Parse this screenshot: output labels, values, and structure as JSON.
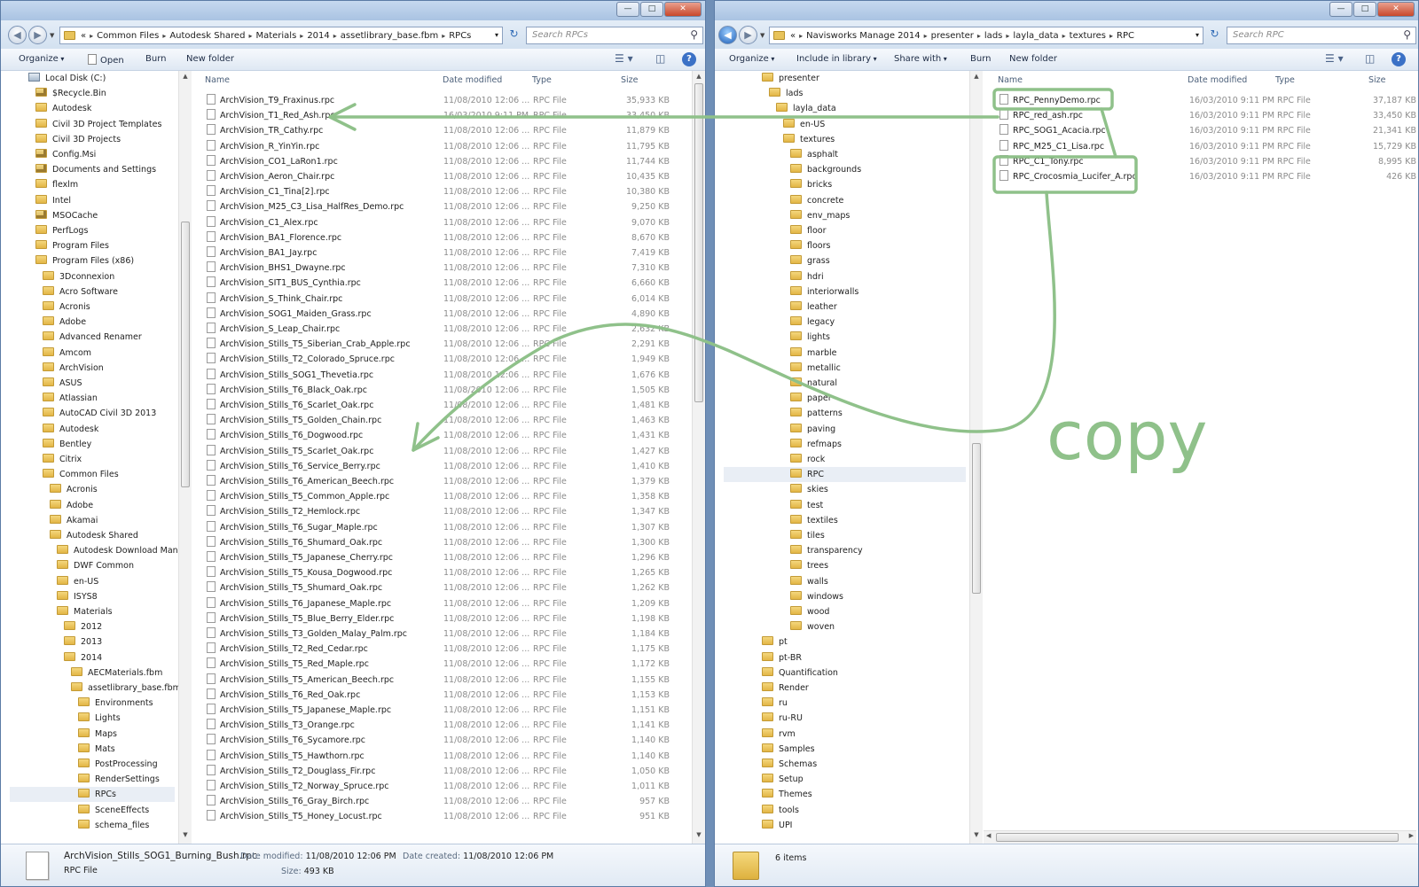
{
  "left": {
    "nav": {
      "back": "◀",
      "forward": "▶"
    },
    "address": [
      "«",
      "Common Files",
      "Autodesk Shared",
      "Materials",
      "2014",
      "assetlibrary_base.fbm",
      "RPCs"
    ],
    "search_placeholder": "Search RPCs",
    "toolbar": {
      "organize": "Organize",
      "open": "Open",
      "burn": "Burn",
      "new_folder": "New folder"
    },
    "columns": {
      "name": "Name",
      "date": "Date modified",
      "type": "Type",
      "size": "Size"
    },
    "tree": [
      {
        "label": "Local Disk (C:)",
        "indent": 0,
        "icon": "drive"
      },
      {
        "label": "$Recycle.Bin",
        "indent": 1,
        "icon": "lock"
      },
      {
        "label": "Autodesk",
        "indent": 1,
        "icon": "folder"
      },
      {
        "label": "Civil 3D Project Templates",
        "indent": 1,
        "icon": "folder"
      },
      {
        "label": "Civil 3D Projects",
        "indent": 1,
        "icon": "folder"
      },
      {
        "label": "Config.Msi",
        "indent": 1,
        "icon": "lock"
      },
      {
        "label": "Documents and Settings",
        "indent": 1,
        "icon": "lock"
      },
      {
        "label": "flexlm",
        "indent": 1,
        "icon": "folder"
      },
      {
        "label": "Intel",
        "indent": 1,
        "icon": "folder"
      },
      {
        "label": "MSOCache",
        "indent": 1,
        "icon": "lock"
      },
      {
        "label": "PerfLogs",
        "indent": 1,
        "icon": "folder"
      },
      {
        "label": "Program Files",
        "indent": 1,
        "icon": "folder"
      },
      {
        "label": "Program Files (x86)",
        "indent": 1,
        "icon": "folder"
      },
      {
        "label": "3Dconnexion",
        "indent": 2,
        "icon": "folder"
      },
      {
        "label": "Acro Software",
        "indent": 2,
        "icon": "folder"
      },
      {
        "label": "Acronis",
        "indent": 2,
        "icon": "folder"
      },
      {
        "label": "Adobe",
        "indent": 2,
        "icon": "folder"
      },
      {
        "label": "Advanced Renamer",
        "indent": 2,
        "icon": "folder"
      },
      {
        "label": "Amcom",
        "indent": 2,
        "icon": "folder"
      },
      {
        "label": "ArchVision",
        "indent": 2,
        "icon": "folder"
      },
      {
        "label": "ASUS",
        "indent": 2,
        "icon": "folder"
      },
      {
        "label": "Atlassian",
        "indent": 2,
        "icon": "folder"
      },
      {
        "label": "AutoCAD Civil 3D 2013",
        "indent": 2,
        "icon": "folder"
      },
      {
        "label": "Autodesk",
        "indent": 2,
        "icon": "folder"
      },
      {
        "label": "Bentley",
        "indent": 2,
        "icon": "folder"
      },
      {
        "label": "Citrix",
        "indent": 2,
        "icon": "folder"
      },
      {
        "label": "Common Files",
        "indent": 2,
        "icon": "folder"
      },
      {
        "label": "Acronis",
        "indent": 3,
        "icon": "folder"
      },
      {
        "label": "Adobe",
        "indent": 3,
        "icon": "folder"
      },
      {
        "label": "Akamai",
        "indent": 3,
        "icon": "folder"
      },
      {
        "label": "Autodesk Shared",
        "indent": 3,
        "icon": "folder"
      },
      {
        "label": "Autodesk Download Mana",
        "indent": 4,
        "icon": "folder"
      },
      {
        "label": "DWF Common",
        "indent": 4,
        "icon": "folder"
      },
      {
        "label": "en-US",
        "indent": 4,
        "icon": "folder"
      },
      {
        "label": "ISYS8",
        "indent": 4,
        "icon": "folder"
      },
      {
        "label": "Materials",
        "indent": 4,
        "icon": "folder"
      },
      {
        "label": "2012",
        "indent": 5,
        "icon": "folder"
      },
      {
        "label": "2013",
        "indent": 5,
        "icon": "folder"
      },
      {
        "label": "2014",
        "indent": 5,
        "icon": "folder"
      },
      {
        "label": "AECMaterials.fbm",
        "indent": 6,
        "icon": "folder"
      },
      {
        "label": "assetlibrary_base.fbm",
        "indent": 6,
        "icon": "folder"
      },
      {
        "label": "Environments",
        "indent": 7,
        "icon": "folder"
      },
      {
        "label": "Lights",
        "indent": 7,
        "icon": "folder"
      },
      {
        "label": "Maps",
        "indent": 7,
        "icon": "folder"
      },
      {
        "label": "Mats",
        "indent": 7,
        "icon": "folder"
      },
      {
        "label": "PostProcessing",
        "indent": 7,
        "icon": "folder"
      },
      {
        "label": "RenderSettings",
        "indent": 7,
        "icon": "folder"
      },
      {
        "label": "RPCs",
        "indent": 7,
        "icon": "folder",
        "selected": true
      },
      {
        "label": "SceneEffects",
        "indent": 7,
        "icon": "folder"
      },
      {
        "label": "schema_files",
        "indent": 7,
        "icon": "folder"
      }
    ],
    "files": [
      {
        "name": "ArchVision_T9_Fraxinus.rpc",
        "date": "11/08/2010 12:06 ...",
        "type": "RPC File",
        "size": "35,933 KB"
      },
      {
        "name": "ArchVision_T1_Red_Ash.rpc",
        "date": "16/03/2010 9:11 PM",
        "type": "RPC File",
        "size": "33,450 KB"
      },
      {
        "name": "ArchVision_TR_Cathy.rpc",
        "date": "11/08/2010 12:06 ...",
        "type": "RPC File",
        "size": "11,879 KB"
      },
      {
        "name": "ArchVision_R_YinYin.rpc",
        "date": "11/08/2010 12:06 ...",
        "type": "RPC File",
        "size": "11,795 KB"
      },
      {
        "name": "ArchVision_CO1_LaRon1.rpc",
        "date": "11/08/2010 12:06 ...",
        "type": "RPC File",
        "size": "11,744 KB"
      },
      {
        "name": "ArchVision_Aeron_Chair.rpc",
        "date": "11/08/2010 12:06 ...",
        "type": "RPC File",
        "size": "10,435 KB"
      },
      {
        "name": "ArchVision_C1_Tina[2].rpc",
        "date": "11/08/2010 12:06 ...",
        "type": "RPC File",
        "size": "10,380 KB"
      },
      {
        "name": "ArchVision_M25_C3_Lisa_HalfRes_Demo.rpc",
        "date": "11/08/2010 12:06 ...",
        "type": "RPC File",
        "size": "9,250 KB"
      },
      {
        "name": "ArchVision_C1_Alex.rpc",
        "date": "11/08/2010 12:06 ...",
        "type": "RPC File",
        "size": "9,070 KB"
      },
      {
        "name": "ArchVision_BA1_Florence.rpc",
        "date": "11/08/2010 12:06 ...",
        "type": "RPC File",
        "size": "8,670 KB"
      },
      {
        "name": "ArchVision_BA1_Jay.rpc",
        "date": "11/08/2010 12:06 ...",
        "type": "RPC File",
        "size": "7,419 KB"
      },
      {
        "name": "ArchVision_BHS1_Dwayne.rpc",
        "date": "11/08/2010 12:06 ...",
        "type": "RPC File",
        "size": "7,310 KB"
      },
      {
        "name": "ArchVision_SIT1_BUS_Cynthia.rpc",
        "date": "11/08/2010 12:06 ...",
        "type": "RPC File",
        "size": "6,660 KB"
      },
      {
        "name": "ArchVision_S_Think_Chair.rpc",
        "date": "11/08/2010 12:06 ...",
        "type": "RPC File",
        "size": "6,014 KB"
      },
      {
        "name": "ArchVision_SOG1_Maiden_Grass.rpc",
        "date": "11/08/2010 12:06 ...",
        "type": "RPC File",
        "size": "4,890 KB"
      },
      {
        "name": "ArchVision_S_Leap_Chair.rpc",
        "date": "11/08/2010 12:06 ...",
        "type": "RPC File",
        "size": "2,632 KB"
      },
      {
        "name": "ArchVision_Stills_T5_Siberian_Crab_Apple.rpc",
        "date": "11/08/2010 12:06 ...",
        "type": "RPC File",
        "size": "2,291 KB"
      },
      {
        "name": "ArchVision_Stills_T2_Colorado_Spruce.rpc",
        "date": "11/08/2010 12:06 ...",
        "type": "RPC File",
        "size": "1,949 KB"
      },
      {
        "name": "ArchVision_Stills_SOG1_Thevetia.rpc",
        "date": "11/08/2010 12:06 ...",
        "type": "RPC File",
        "size": "1,676 KB"
      },
      {
        "name": "ArchVision_Stills_T6_Black_Oak.rpc",
        "date": "11/08/2010 12:06 ...",
        "type": "RPC File",
        "size": "1,505 KB"
      },
      {
        "name": "ArchVision_Stills_T6_Scarlet_Oak.rpc",
        "date": "11/08/2010 12:06 ...",
        "type": "RPC File",
        "size": "1,481 KB"
      },
      {
        "name": "ArchVision_Stills_T5_Golden_Chain.rpc",
        "date": "11/08/2010 12:06 ...",
        "type": "RPC File",
        "size": "1,463 KB"
      },
      {
        "name": "ArchVision_Stills_T6_Dogwood.rpc",
        "date": "11/08/2010 12:06 ...",
        "type": "RPC File",
        "size": "1,431 KB"
      },
      {
        "name": "ArchVision_Stills_T5_Scarlet_Oak.rpc",
        "date": "11/08/2010 12:06 ...",
        "type": "RPC File",
        "size": "1,427 KB"
      },
      {
        "name": "ArchVision_Stills_T6_Service_Berry.rpc",
        "date": "11/08/2010 12:06 ...",
        "type": "RPC File",
        "size": "1,410 KB"
      },
      {
        "name": "ArchVision_Stills_T6_American_Beech.rpc",
        "date": "11/08/2010 12:06 ...",
        "type": "RPC File",
        "size": "1,379 KB"
      },
      {
        "name": "ArchVision_Stills_T5_Common_Apple.rpc",
        "date": "11/08/2010 12:06 ...",
        "type": "RPC File",
        "size": "1,358 KB"
      },
      {
        "name": "ArchVision_Stills_T2_Hemlock.rpc",
        "date": "11/08/2010 12:06 ...",
        "type": "RPC File",
        "size": "1,347 KB"
      },
      {
        "name": "ArchVision_Stills_T6_Sugar_Maple.rpc",
        "date": "11/08/2010 12:06 ...",
        "type": "RPC File",
        "size": "1,307 KB"
      },
      {
        "name": "ArchVision_Stills_T6_Shumard_Oak.rpc",
        "date": "11/08/2010 12:06 ...",
        "type": "RPC File",
        "size": "1,300 KB"
      },
      {
        "name": "ArchVision_Stills_T5_Japanese_Cherry.rpc",
        "date": "11/08/2010 12:06 ...",
        "type": "RPC File",
        "size": "1,296 KB"
      },
      {
        "name": "ArchVision_Stills_T5_Kousa_Dogwood.rpc",
        "date": "11/08/2010 12:06 ...",
        "type": "RPC File",
        "size": "1,265 KB"
      },
      {
        "name": "ArchVision_Stills_T5_Shumard_Oak.rpc",
        "date": "11/08/2010 12:06 ...",
        "type": "RPC File",
        "size": "1,262 KB"
      },
      {
        "name": "ArchVision_Stills_T6_Japanese_Maple.rpc",
        "date": "11/08/2010 12:06 ...",
        "type": "RPC File",
        "size": "1,209 KB"
      },
      {
        "name": "ArchVision_Stills_T5_Blue_Berry_Elder.rpc",
        "date": "11/08/2010 12:06 ...",
        "type": "RPC File",
        "size": "1,198 KB"
      },
      {
        "name": "ArchVision_Stills_T3_Golden_Malay_Palm.rpc",
        "date": "11/08/2010 12:06 ...",
        "type": "RPC File",
        "size": "1,184 KB"
      },
      {
        "name": "ArchVision_Stills_T2_Red_Cedar.rpc",
        "date": "11/08/2010 12:06 ...",
        "type": "RPC File",
        "size": "1,175 KB"
      },
      {
        "name": "ArchVision_Stills_T5_Red_Maple.rpc",
        "date": "11/08/2010 12:06 ...",
        "type": "RPC File",
        "size": "1,172 KB"
      },
      {
        "name": "ArchVision_Stills_T5_American_Beech.rpc",
        "date": "11/08/2010 12:06 ...",
        "type": "RPC File",
        "size": "1,155 KB"
      },
      {
        "name": "ArchVision_Stills_T6_Red_Oak.rpc",
        "date": "11/08/2010 12:06 ...",
        "type": "RPC File",
        "size": "1,153 KB"
      },
      {
        "name": "ArchVision_Stills_T5_Japanese_Maple.rpc",
        "date": "11/08/2010 12:06 ...",
        "type": "RPC File",
        "size": "1,151 KB"
      },
      {
        "name": "ArchVision_Stills_T3_Orange.rpc",
        "date": "11/08/2010 12:06 ...",
        "type": "RPC File",
        "size": "1,141 KB"
      },
      {
        "name": "ArchVision_Stills_T6_Sycamore.rpc",
        "date": "11/08/2010 12:06 ...",
        "type": "RPC File",
        "size": "1,140 KB"
      },
      {
        "name": "ArchVision_Stills_T5_Hawthorn.rpc",
        "date": "11/08/2010 12:06 ...",
        "type": "RPC File",
        "size": "1,140 KB"
      },
      {
        "name": "ArchVision_Stills_T2_Douglass_Fir.rpc",
        "date": "11/08/2010 12:06 ...",
        "type": "RPC File",
        "size": "1,050 KB"
      },
      {
        "name": "ArchVision_Stills_T2_Norway_Spruce.rpc",
        "date": "11/08/2010 12:06 ...",
        "type": "RPC File",
        "size": "1,011 KB"
      },
      {
        "name": "ArchVision_Stills_T6_Gray_Birch.rpc",
        "date": "11/08/2010 12:06 ...",
        "type": "RPC File",
        "size": "957 KB"
      },
      {
        "name": "ArchVision_Stills_T5_Honey_Locust.rpc",
        "date": "11/08/2010 12:06 ...",
        "type": "RPC File",
        "size": "951 KB"
      }
    ],
    "details": {
      "filename": "ArchVision_Stills_SOG1_Burning_Bush.rpc",
      "filetype": "RPC File",
      "modified_label": "Date modified:",
      "modified": "11/08/2010 12:06 PM",
      "created_label": "Date created:",
      "created": "11/08/2010 12:06 PM",
      "size_label": "Size:",
      "size": "493 KB"
    }
  },
  "right": {
    "nav": {
      "back": "◀",
      "forward": "▶"
    },
    "address": [
      "«",
      "Navisworks Manage 2014",
      "presenter",
      "lads",
      "layla_data",
      "textures",
      "RPC"
    ],
    "search_placeholder": "Search RPC",
    "toolbar": {
      "organize": "Organize",
      "include": "Include in library",
      "share": "Share with",
      "burn": "Burn",
      "new_folder": "New folder"
    },
    "columns": {
      "name": "Name",
      "date": "Date modified",
      "type": "Type",
      "size": "Size"
    },
    "tree": [
      {
        "label": "presenter",
        "indent": 0
      },
      {
        "label": "lads",
        "indent": 1
      },
      {
        "label": "layla_data",
        "indent": 2
      },
      {
        "label": "en-US",
        "indent": 3
      },
      {
        "label": "textures",
        "indent": 3
      },
      {
        "label": "asphalt",
        "indent": 4
      },
      {
        "label": "backgrounds",
        "indent": 4
      },
      {
        "label": "bricks",
        "indent": 4
      },
      {
        "label": "concrete",
        "indent": 4
      },
      {
        "label": "env_maps",
        "indent": 4
      },
      {
        "label": "floor",
        "indent": 4
      },
      {
        "label": "floors",
        "indent": 4
      },
      {
        "label": "grass",
        "indent": 4
      },
      {
        "label": "hdri",
        "indent": 4
      },
      {
        "label": "interiorwalls",
        "indent": 4
      },
      {
        "label": "leather",
        "indent": 4
      },
      {
        "label": "legacy",
        "indent": 4
      },
      {
        "label": "lights",
        "indent": 4
      },
      {
        "label": "marble",
        "indent": 4
      },
      {
        "label": "metallic",
        "indent": 4
      },
      {
        "label": "natural",
        "indent": 4
      },
      {
        "label": "paper",
        "indent": 4
      },
      {
        "label": "patterns",
        "indent": 4
      },
      {
        "label": "paving",
        "indent": 4
      },
      {
        "label": "refmaps",
        "indent": 4
      },
      {
        "label": "rock",
        "indent": 4
      },
      {
        "label": "RPC",
        "indent": 4,
        "selected": true
      },
      {
        "label": "skies",
        "indent": 4
      },
      {
        "label": "test",
        "indent": 4
      },
      {
        "label": "textiles",
        "indent": 4
      },
      {
        "label": "tiles",
        "indent": 4
      },
      {
        "label": "transparency",
        "indent": 4
      },
      {
        "label": "trees",
        "indent": 4
      },
      {
        "label": "walls",
        "indent": 4
      },
      {
        "label": "windows",
        "indent": 4
      },
      {
        "label": "wood",
        "indent": 4
      },
      {
        "label": "woven",
        "indent": 4
      },
      {
        "label": "pt",
        "indent": 0
      },
      {
        "label": "pt-BR",
        "indent": 0
      },
      {
        "label": "Quantification",
        "indent": 0
      },
      {
        "label": "Render",
        "indent": 0
      },
      {
        "label": "ru",
        "indent": 0
      },
      {
        "label": "ru-RU",
        "indent": 0
      },
      {
        "label": "rvm",
        "indent": 0
      },
      {
        "label": "Samples",
        "indent": 0
      },
      {
        "label": "Schemas",
        "indent": 0
      },
      {
        "label": "Setup",
        "indent": 0
      },
      {
        "label": "Themes",
        "indent": 0
      },
      {
        "label": "tools",
        "indent": 0
      },
      {
        "label": "UPI",
        "indent": 0
      }
    ],
    "files": [
      {
        "name": "RPC_PennyDemo.rpc",
        "date": "16/03/2010 9:11 PM",
        "type": "RPC File",
        "size": "37,187 KB"
      },
      {
        "name": "RPC_red_ash.rpc",
        "date": "16/03/2010 9:11 PM",
        "type": "RPC File",
        "size": "33,450 KB"
      },
      {
        "name": "RPC_SOG1_Acacia.rpc",
        "date": "16/03/2010 9:11 PM",
        "type": "RPC File",
        "size": "21,341 KB"
      },
      {
        "name": "RPC_M25_C1_Lisa.rpc",
        "date": "16/03/2010 9:11 PM",
        "type": "RPC File",
        "size": "15,729 KB"
      },
      {
        "name": "RPC_C1_Tony.rpc",
        "date": "16/03/2010 9:11 PM",
        "type": "RPC File",
        "size": "8,995 KB"
      },
      {
        "name": "RPC_Crocosmia_Lucifer_A.rpc",
        "date": "16/03/2010 9:11 PM",
        "type": "RPC File",
        "size": "426 KB"
      }
    ],
    "details": {
      "count": "6 items"
    }
  },
  "annotation": {
    "copy_label": "copy",
    "color": "#8fc18a"
  }
}
